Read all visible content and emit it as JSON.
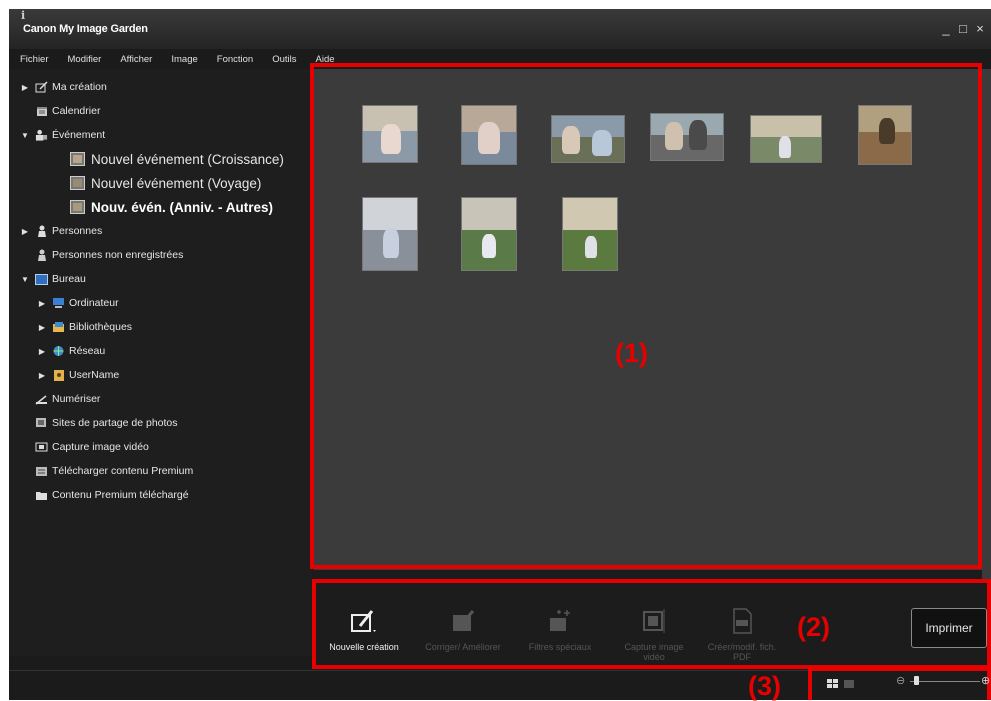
{
  "window": {
    "title": "Canon My Image Garden",
    "controls": [
      "_",
      "□",
      "×"
    ]
  },
  "menu": [
    "Fichier",
    "Modifier",
    "Afficher",
    "Image",
    "Fonction",
    "Outils",
    "Aide"
  ],
  "sidebar": {
    "items": [
      {
        "label": "Ma création",
        "icon": "my-art-icon",
        "arrow": "collapsed"
      },
      {
        "label": "Calendrier",
        "icon": "calendar-icon",
        "arrow": "none"
      },
      {
        "label": "Événement",
        "icon": "event-icon",
        "arrow": "expanded"
      },
      {
        "label": "Nouvel événement (Croissance)",
        "icon": "event-photo-icon",
        "arrow": "none"
      },
      {
        "label": "Nouvel événement (Voyage)",
        "icon": "event-photo-icon",
        "arrow": "none"
      },
      {
        "label": "Nouv. évén. (Anniv. - Autres)",
        "icon": "event-photo-icon",
        "arrow": "none"
      },
      {
        "label": "Personnes",
        "icon": "person-icon",
        "arrow": "collapsed"
      },
      {
        "label": "Personnes non enregistrées",
        "icon": "unregistered-person-icon",
        "arrow": "none"
      },
      {
        "label": "Bureau",
        "icon": "desktop-icon",
        "arrow": "expanded"
      },
      {
        "label": "Ordinateur",
        "icon": "computer-icon",
        "arrow": "collapsed"
      },
      {
        "label": "Bibliothèques",
        "icon": "libraries-icon",
        "arrow": "collapsed"
      },
      {
        "label": "Réseau",
        "icon": "network-icon",
        "arrow": "collapsed"
      },
      {
        "label": "UserName",
        "icon": "user-folder-icon",
        "arrow": "collapsed"
      },
      {
        "label": "Numériser",
        "icon": "scan-icon",
        "arrow": "none"
      },
      {
        "label": "Sites de partage de photos",
        "icon": "photo-sharing-icon",
        "arrow": "none"
      },
      {
        "label": "Capture image vidéo",
        "icon": "video-capture-icon",
        "arrow": "none"
      },
      {
        "label": "Télécharger contenu Premium",
        "icon": "download-premium-icon",
        "arrow": "none"
      },
      {
        "label": "Contenu Premium téléchargé",
        "icon": "premium-folder-icon",
        "arrow": "none"
      }
    ]
  },
  "annotations": {
    "area1": "(1)",
    "area2": "(2)",
    "area3": "(3)"
  },
  "toolbar": {
    "tools": [
      {
        "label": "Nouvelle création",
        "icon": "new-art-icon",
        "enabled": true
      },
      {
        "label": "Corriger/ Améliorer",
        "icon": "correct-enhance-icon",
        "enabled": false
      },
      {
        "label": "Filtres spéciaux",
        "icon": "special-filters-icon",
        "enabled": false
      },
      {
        "label": "Capture image vidéo",
        "icon": "video-frame-capture-icon",
        "enabled": false
      },
      {
        "label": "Créer/modif. fich. PDF",
        "icon": "pdf-icon",
        "enabled": false
      }
    ],
    "print_label": "Imprimer"
  },
  "statusbar": {
    "info_icon": "info-icon",
    "zoom_minus": "⊖",
    "zoom_plus": "⊕",
    "zoom_level": 0.06
  },
  "colors": {
    "accent_red": "#e60000",
    "content_bg": "#3b3b3b",
    "sidebar_bg": "#1e1e1e"
  }
}
